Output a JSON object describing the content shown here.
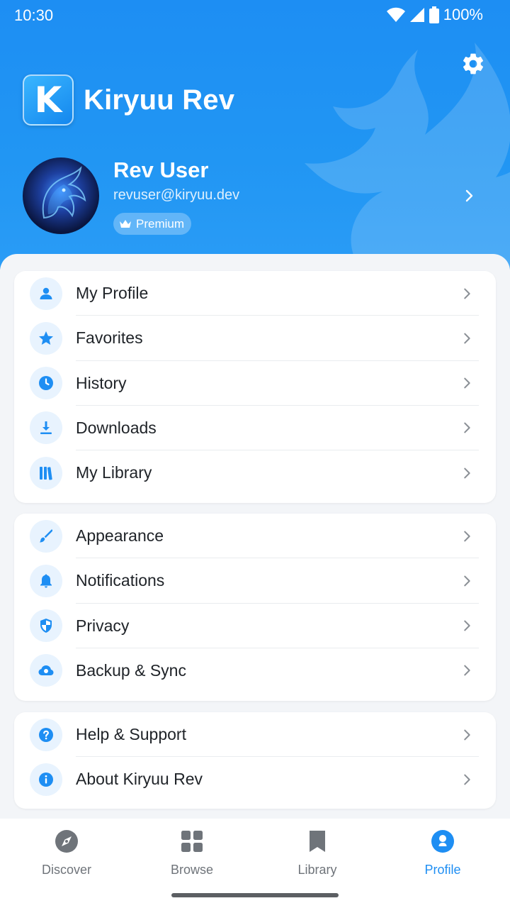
{
  "status": {
    "time": "10:30",
    "battery": "100%"
  },
  "header": {
    "app_name": "Kiryuu Rev",
    "logo_letter": "K"
  },
  "user": {
    "name": "Rev User",
    "email": "revuser@kiryuu.dev",
    "badge": "Premium"
  },
  "colors": {
    "accent": "#2196f3",
    "icon_bg": "#e8f3fe",
    "text": "#1f2328",
    "muted": "#6f747a"
  },
  "groups": [
    {
      "items": [
        {
          "label": "My Profile",
          "icon": "person-icon"
        },
        {
          "label": "Favorites",
          "icon": "star-icon"
        },
        {
          "label": "History",
          "icon": "clock-icon"
        },
        {
          "label": "Downloads",
          "icon": "download-icon"
        },
        {
          "label": "My Library",
          "icon": "library-icon"
        }
      ]
    },
    {
      "items": [
        {
          "label": "Appearance",
          "icon": "brush-icon"
        },
        {
          "label": "Notifications",
          "icon": "bell-icon"
        },
        {
          "label": "Privacy",
          "icon": "shield-icon"
        },
        {
          "label": "Backup & Sync",
          "icon": "cloud-sync-icon"
        }
      ]
    },
    {
      "items": [
        {
          "label": "Help & Support",
          "icon": "help-icon"
        },
        {
          "label": "About Kiryuu Rev",
          "icon": "info-icon"
        }
      ]
    }
  ],
  "nav": [
    {
      "label": "Discover",
      "icon": "compass-icon",
      "active": false
    },
    {
      "label": "Browse",
      "icon": "grid-icon",
      "active": false
    },
    {
      "label": "Library",
      "icon": "bookmark-icon",
      "active": false
    },
    {
      "label": "Profile",
      "icon": "profile-icon",
      "active": true
    }
  ]
}
